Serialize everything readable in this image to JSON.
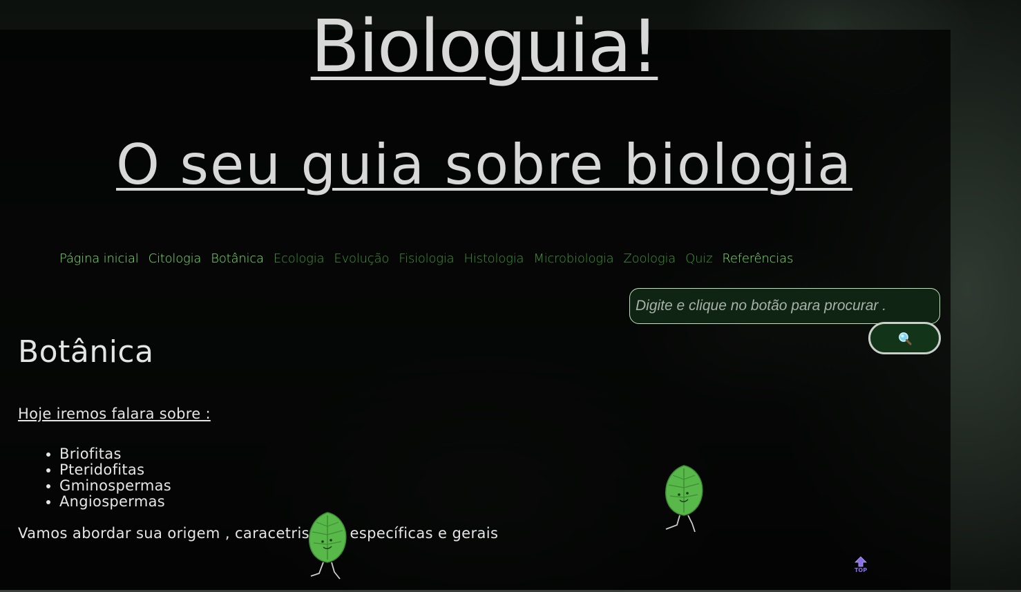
{
  "header": {
    "title": "Biologuia!",
    "subtitle": "O seu guia sobre biologia"
  },
  "nav": {
    "items": [
      {
        "label": "Página inicial",
        "style": "bright"
      },
      {
        "label": "Citologia",
        "style": "bright"
      },
      {
        "label": "Botânica",
        "style": "bright"
      },
      {
        "label": "Ecologia",
        "style": "dim"
      },
      {
        "label": "Evolução",
        "style": "dim"
      },
      {
        "label": "Fisiologia",
        "style": "dim"
      },
      {
        "label": "Histologia",
        "style": "dim"
      },
      {
        "label": "Microbiologia",
        "style": "dim"
      },
      {
        "label": "Zoologia",
        "style": "dim"
      },
      {
        "label": "Quiz",
        "style": "dim"
      },
      {
        "label": "Referências",
        "style": "bright"
      }
    ]
  },
  "search": {
    "placeholder": "Digite e clique no botão para procurar .",
    "button_icon": "magnifier-icon"
  },
  "content": {
    "section_title": "Botânica",
    "intro": "Hoje iremos falara sobre :",
    "topics": [
      "Briofitas",
      "Pteridofitas",
      "Gminospermas",
      "Angiospermas"
    ],
    "summary": "Vamos abordar sua origem , caracetristicas específicas e gerais"
  },
  "back_to_top": {
    "label": "TOP",
    "icon": "arrow-up-icon"
  },
  "decorations": {
    "leaf_icon": "walking-leaf-icon"
  },
  "colors": {
    "nav_bright": "#7de86a",
    "nav_dim": "#3e9a33",
    "text": "#e6e6e6",
    "search_bg": "#0f2412",
    "top_accent": "#8a6ee8"
  }
}
